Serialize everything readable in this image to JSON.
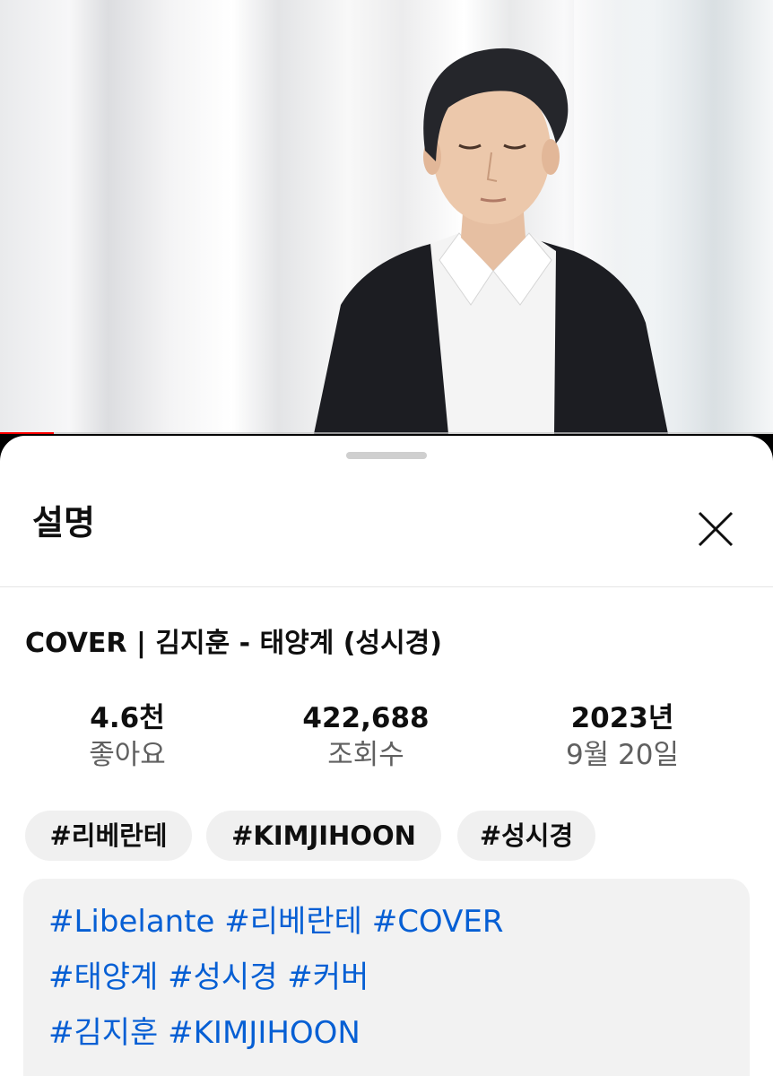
{
  "player": {
    "progress_fraction": 0.07,
    "accent": "#ff0000"
  },
  "sheet": {
    "title": "설명",
    "close_icon": "close-icon"
  },
  "video": {
    "title": "COVER | 김지훈 - 태양계 (성시경)"
  },
  "stats": {
    "likes_value": "4.6천",
    "likes_label": "좋아요",
    "views_value": "422,688",
    "views_label": "조회수",
    "date_year": "2023년",
    "date_day": "9월 20일"
  },
  "tags": [
    "#리베란테",
    "#KIMJIHOON",
    "#성시경"
  ],
  "description": {
    "link_color": "#065fd4",
    "lines": [
      [
        "#Libelante",
        "#리베란테",
        "#COVER"
      ],
      [
        "#태양계",
        "#성시경",
        "#커버"
      ],
      [
        "#김지훈",
        "#KIMJIHOON"
      ]
    ]
  }
}
